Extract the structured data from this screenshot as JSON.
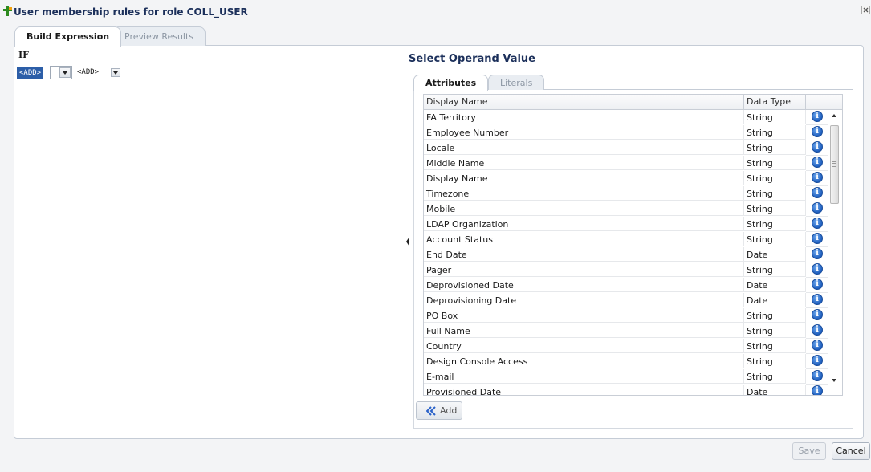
{
  "header": {
    "title": "User membership rules for role COLL_USER"
  },
  "tabs": [
    {
      "label": "Build Expression",
      "active": true
    },
    {
      "label": "Preview Results",
      "active": false
    }
  ],
  "expression": {
    "if_label": "IF",
    "add_chip": "<ADD>",
    "add_text": "<ADD>"
  },
  "operand": {
    "title": "Select Operand Value",
    "subtabs": [
      {
        "label": "Attributes",
        "active": true
      },
      {
        "label": "Literals",
        "active": false
      }
    ],
    "columns": [
      "Display Name",
      "Data Type",
      ""
    ],
    "rows": [
      {
        "name": "FA Territory",
        "type": "String"
      },
      {
        "name": "Employee Number",
        "type": "String"
      },
      {
        "name": "Locale",
        "type": "String"
      },
      {
        "name": "Middle Name",
        "type": "String"
      },
      {
        "name": "Display Name",
        "type": "String"
      },
      {
        "name": "Timezone",
        "type": "String"
      },
      {
        "name": "Mobile",
        "type": "String"
      },
      {
        "name": "LDAP Organization",
        "type": "String"
      },
      {
        "name": "Account Status",
        "type": "String"
      },
      {
        "name": "End Date",
        "type": "Date"
      },
      {
        "name": "Pager",
        "type": "String"
      },
      {
        "name": "Deprovisioned Date",
        "type": "Date"
      },
      {
        "name": "Deprovisioning Date",
        "type": "Date"
      },
      {
        "name": "PO Box",
        "type": "String"
      },
      {
        "name": "Full Name",
        "type": "String"
      },
      {
        "name": "Country",
        "type": "String"
      },
      {
        "name": "Design Console Access",
        "type": "String"
      },
      {
        "name": "E-mail",
        "type": "String"
      },
      {
        "name": "Provisioned Date",
        "type": "Date"
      }
    ],
    "add_button": "Add"
  },
  "footer": {
    "save": "Save",
    "cancel": "Cancel"
  },
  "icons": {
    "title": "rule-icon",
    "close": "close-icon",
    "info": "info-icon",
    "add": "add-arrow-icon",
    "collapse": "collapse-left-icon"
  },
  "colors": {
    "accent": "#1b2f5a",
    "chip": "#2c5ea8",
    "info": "#1f5fbf"
  }
}
